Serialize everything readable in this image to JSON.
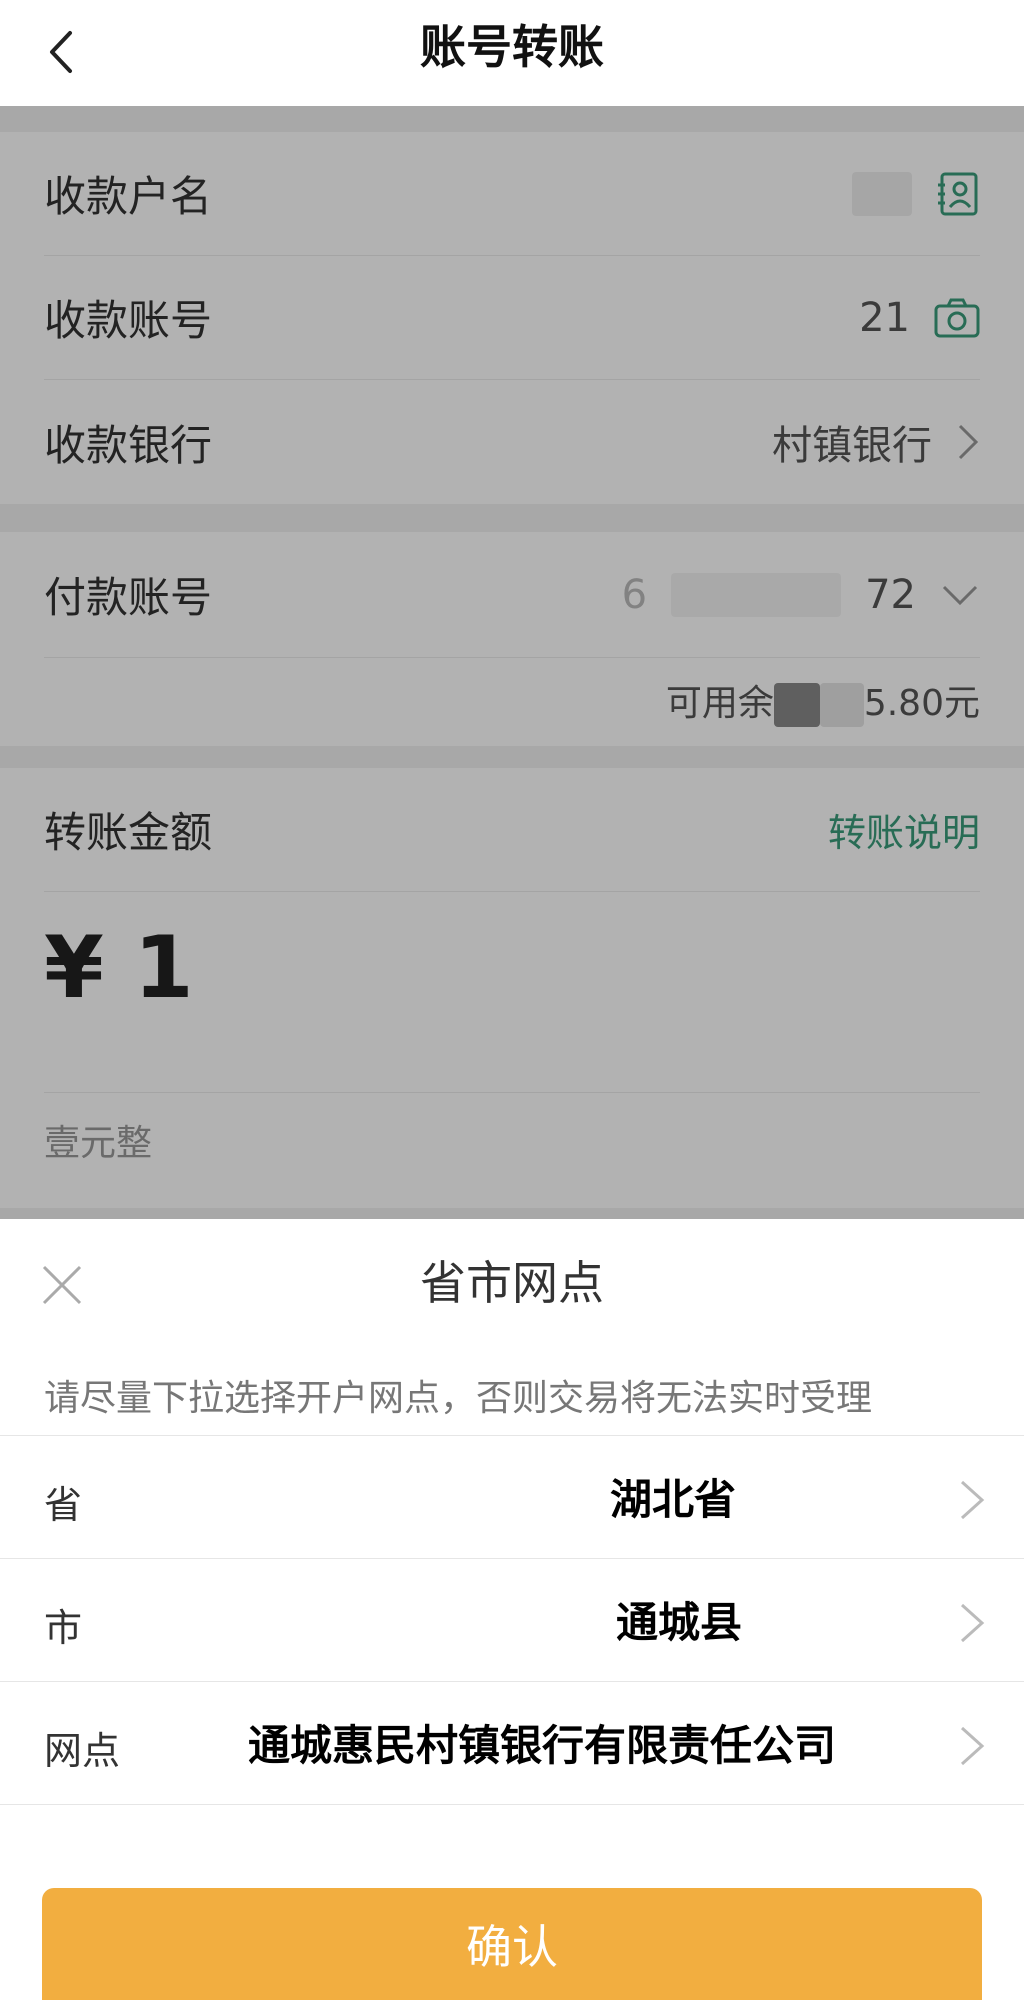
{
  "nav": {
    "title": "账号转账"
  },
  "form": {
    "payee_name_label": "收款户名",
    "payee_account_label": "收款账号",
    "payee_account_tail": "21",
    "payee_bank_label": "收款银行",
    "payee_bank_value": "村镇银行",
    "payer_account_label": "付款账号",
    "payer_account_head": "6",
    "payer_account_tail": "72",
    "balance_prefix": "可用余",
    "balance_suffix": "5.80元",
    "amount_label": "转账金额",
    "transfer_info_link": "转账说明",
    "amount_value": "¥ 1",
    "amount_in_words": "壹元整"
  },
  "sheet": {
    "title": "省市网点",
    "hint": "请尽量下拉选择开户网点，否则交易将无法实时受理",
    "rows": [
      {
        "label": "省",
        "value": "湖北省"
      },
      {
        "label": "市",
        "value": "通城县"
      },
      {
        "label": "网点",
        "value": "通城惠民村镇银行有限责任公司"
      }
    ],
    "confirm_label": "确认"
  },
  "colors": {
    "accent_green": "#3a9b7a",
    "confirm_orange": "#f2ae40"
  },
  "icons": [
    "back-arrow-icon",
    "contact-card-icon",
    "camera-icon",
    "chevron-right-icon",
    "chevron-down-icon",
    "close-icon"
  ]
}
